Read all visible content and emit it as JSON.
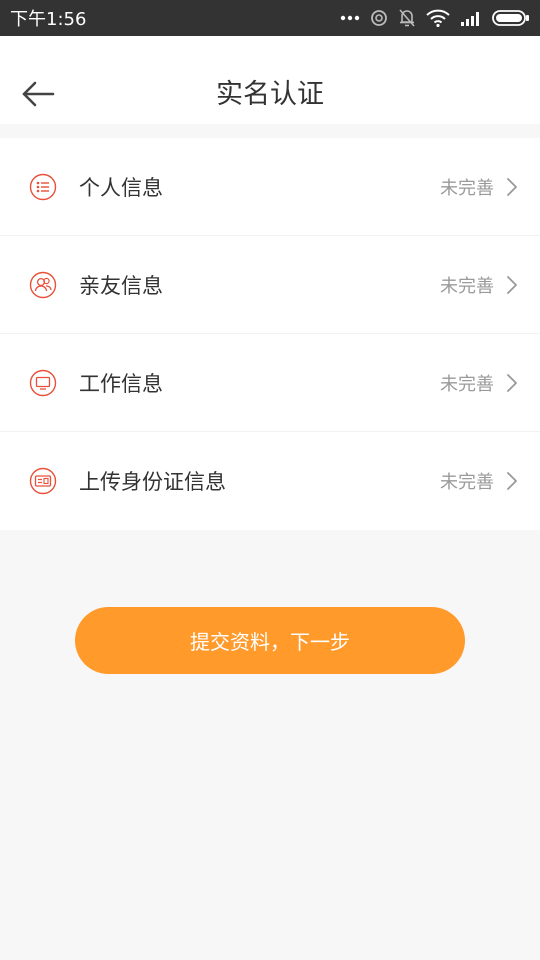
{
  "status_bar": {
    "time": "下午1:56",
    "icons": [
      "more-dots-icon",
      "sync-icon",
      "bell-off-icon",
      "wifi-icon",
      "signal-icon",
      "battery-icon"
    ]
  },
  "header": {
    "back_icon": "arrow-left-icon",
    "title": "实名认证"
  },
  "items": [
    {
      "icon": "list-icon",
      "label": "个人信息",
      "status": "未完善"
    },
    {
      "icon": "contacts-icon",
      "label": "亲友信息",
      "status": "未完善"
    },
    {
      "icon": "monitor-icon",
      "label": "工作信息",
      "status": "未完善"
    },
    {
      "icon": "id-card-icon",
      "label": "上传身份证信息",
      "status": "未完善"
    }
  ],
  "submit": {
    "label": "提交资料，下一步"
  },
  "colors": {
    "accent": "#ff9a2b",
    "icon_red": "#e8503a",
    "status_bar": "#333333",
    "background": "#f7f7f7"
  }
}
